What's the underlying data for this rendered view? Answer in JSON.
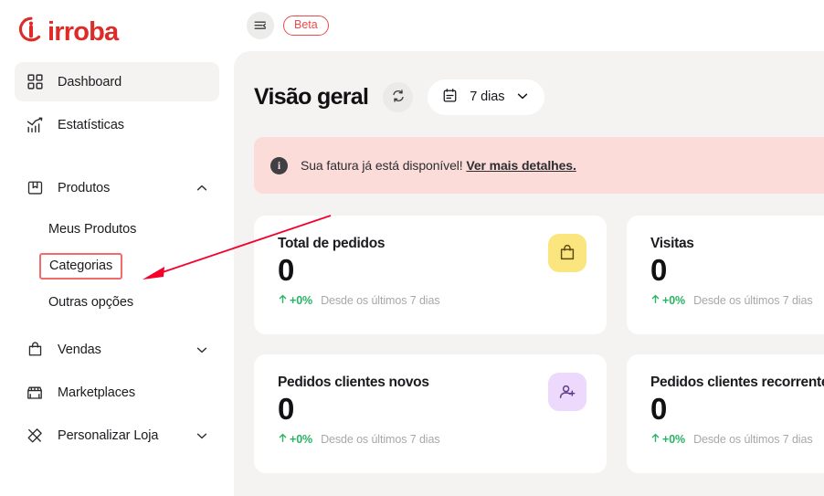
{
  "brand": {
    "name": "irroba",
    "color": "#de2b28",
    "mark": "irroba-logo-mark"
  },
  "sidebar": {
    "items": [
      {
        "label": "Dashboard",
        "icon": "grid-icon",
        "active": true,
        "chevron": ""
      },
      {
        "label": "Estatísticas",
        "icon": "chart-icon",
        "active": false,
        "chevron": ""
      },
      {
        "label": "Produtos",
        "icon": "box-icon",
        "active": false,
        "chevron": "chevron-up-icon"
      },
      {
        "label": "Vendas",
        "icon": "bag-icon",
        "active": false,
        "chevron": "chevron-down-icon"
      },
      {
        "label": "Marketplaces",
        "icon": "storefront-icon",
        "active": false,
        "chevron": ""
      },
      {
        "label": "Personalizar Loja",
        "icon": "brush-icon",
        "active": false,
        "chevron": "chevron-down-icon"
      }
    ],
    "produtos_sub": [
      {
        "label": "Meus Produtos",
        "highlighted": false
      },
      {
        "label": "Categorias",
        "highlighted": true
      },
      {
        "label": "Outras opções",
        "highlighted": false
      }
    ]
  },
  "topbar": {
    "toggle_icon": "menu-collapse-icon",
    "beta_label": "Beta"
  },
  "page": {
    "title": "Visão geral",
    "refresh_icon": "refresh-icon",
    "date_filter": {
      "icon": "calendar-icon",
      "value": "7 dias",
      "chevron": "chevron-down-icon"
    }
  },
  "alert": {
    "icon": "info-icon",
    "text": "Sua fatura já está disponível!",
    "link": "Ver mais detalhes.",
    "background": "#fbdcd9"
  },
  "cards": [
    {
      "title": "Total de pedidos",
      "value": "0",
      "delta": "+0%",
      "delta_arrow": "arrow-up-icon",
      "period": "Desde os últimos 7 dias",
      "badge_icon": "shopping-bag-icon",
      "badge_bg": "#fbe57f",
      "badge_fg": "#5c4a10"
    },
    {
      "title": "Visitas",
      "value": "0",
      "delta": "+0%",
      "delta_arrow": "arrow-up-icon",
      "period": "Desde os últimos 7 dias",
      "badge_icon": "eye-icon",
      "badge_bg": "#d8f0ff",
      "badge_fg": "#1b5777"
    },
    {
      "title": "Pedidos clientes novos",
      "value": "0",
      "delta": "+0%",
      "delta_arrow": "arrow-up-icon",
      "period": "Desde os últimos 7 dias",
      "badge_icon": "user-plus-icon",
      "badge_bg": "#ecd9fb",
      "badge_fg": "#5d3a85"
    },
    {
      "title": "Pedidos clientes recorrentes",
      "value": "0",
      "delta": "+0%",
      "delta_arrow": "arrow-up-icon",
      "period": "Desde os últimos 7 dias",
      "badge_icon": "users-icon",
      "badge_bg": "#d6f7e4",
      "badge_fg": "#1f6b42"
    }
  ],
  "annotation": {
    "arrow_color": "#f4002a",
    "highlight_color": "#f36a6a",
    "target": "Categorias"
  }
}
